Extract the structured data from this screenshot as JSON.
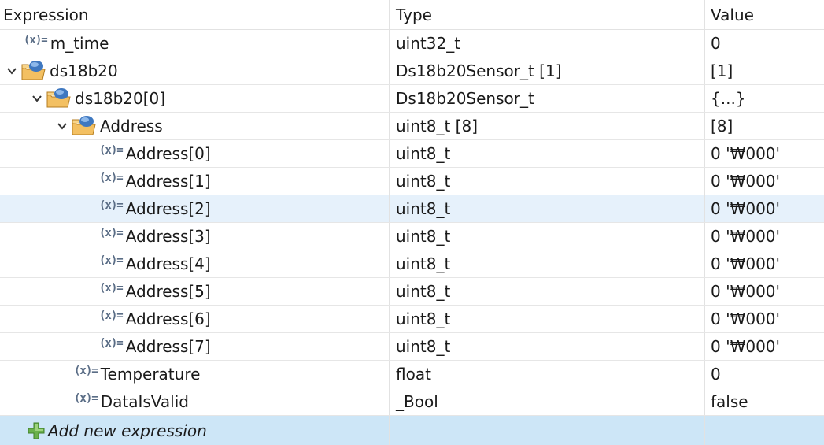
{
  "columns": {
    "expression": "Expression",
    "type": "Type",
    "value": "Value"
  },
  "var_icon_text": "(x)=",
  "rows": [
    {
      "expression": "m_time",
      "type": "uint32_t",
      "value": "0"
    },
    {
      "expression": "ds18b20",
      "type": "Ds18b20Sensor_t [1]",
      "value": "[1]"
    },
    {
      "expression": "ds18b20[0]",
      "type": "Ds18b20Sensor_t",
      "value": "{...}"
    },
    {
      "expression": "Address",
      "type": "uint8_t [8]",
      "value": "[8]"
    },
    {
      "expression": "Address[0]",
      "type": "uint8_t",
      "value": "0 '₩000'"
    },
    {
      "expression": "Address[1]",
      "type": "uint8_t",
      "value": "0 '₩000'"
    },
    {
      "expression": "Address[2]",
      "type": "uint8_t",
      "value": "0 '₩000'"
    },
    {
      "expression": "Address[3]",
      "type": "uint8_t",
      "value": "0 '₩000'"
    },
    {
      "expression": "Address[4]",
      "type": "uint8_t",
      "value": "0 '₩000'"
    },
    {
      "expression": "Address[5]",
      "type": "uint8_t",
      "value": "0 '₩000'"
    },
    {
      "expression": "Address[6]",
      "type": "uint8_t",
      "value": "0 '₩000'"
    },
    {
      "expression": "Address[7]",
      "type": "uint8_t",
      "value": "0 '₩000'"
    },
    {
      "expression": "Temperature",
      "type": "float",
      "value": "0"
    },
    {
      "expression": "DataIsValid",
      "type": "_Bool",
      "value": "false"
    }
  ],
  "add_expression_label": "Add new expression",
  "colors": {
    "selected_row": "#e6f1fb",
    "add_row": "#cde6f7",
    "folder_yellow": "#f3c062",
    "folder_blue": "#3f78c0",
    "plus_green": "#6ab04c"
  },
  "icons": {
    "variable": "variable-icon",
    "struct": "folder-struct-icon",
    "expand": "chevron-down-icon",
    "add": "plus-icon"
  }
}
